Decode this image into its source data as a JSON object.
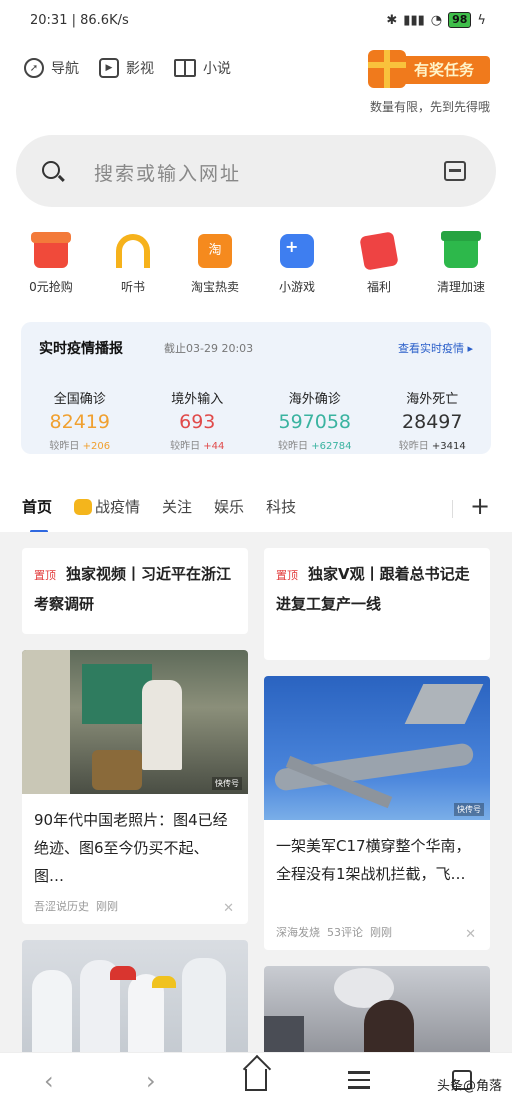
{
  "status": {
    "time": "20:31",
    "speed": "86.6K/s",
    "battery": "98",
    "icons": [
      "bluetooth-icon",
      "hd-signal-icon",
      "wifi-icon",
      "battery-icon",
      "charging-icon"
    ]
  },
  "topnav": [
    {
      "label": "导航",
      "icon": "compass-icon"
    },
    {
      "label": "影视",
      "icon": "play-icon"
    },
    {
      "label": "小说",
      "icon": "book-icon"
    }
  ],
  "reward": {
    "label": "有奖任务",
    "sub": "数量有限，先到先得哦"
  },
  "search": {
    "placeholder": "搜索或输入网址"
  },
  "quick": [
    {
      "label": "0元抢购",
      "icon": "shop-icon"
    },
    {
      "label": "听书",
      "icon": "headphones-icon"
    },
    {
      "label": "淘宝热卖",
      "icon": "taobao-bag-icon",
      "glyph": "淘"
    },
    {
      "label": "小游戏",
      "icon": "gamepad-icon"
    },
    {
      "label": "福利",
      "icon": "red-envelope-icon"
    },
    {
      "label": "清理加速",
      "icon": "trash-icon"
    }
  ],
  "epidemic": {
    "title": "实时疫情播报",
    "date": "截止03-29  20:03",
    "more": "查看实时疫情 ▸",
    "prefix": "较昨日",
    "stats": [
      {
        "label": "全国确诊",
        "value": "82419",
        "delta": "+206",
        "color": "#f0a030"
      },
      {
        "label": "境外输入",
        "value": "693",
        "delta": "+44",
        "color": "#e04a4a"
      },
      {
        "label": "海外确诊",
        "value": "597058",
        "delta": "+62784",
        "color": "#3ab3a0"
      },
      {
        "label": "海外死亡",
        "value": "28497",
        "delta": "+3414",
        "color": "#333333"
      }
    ]
  },
  "tabs": [
    "首页",
    "战疫情",
    "关注",
    "娱乐",
    "科技"
  ],
  "feed": {
    "pin_label": "置顶",
    "cards": [
      {
        "text": "独家视频丨习近平在浙江考察调研"
      },
      {
        "text": "独家V观丨跟着总书记走进复工复产一线"
      },
      {
        "text": "90年代中国老照片：图4已经绝迹、图6至今仍买不起、图…",
        "source": "吾涩说历史",
        "time": "刚刚",
        "watermark": "快传号"
      },
      {
        "text": "一架美军C17横穿整个华南，全程没有1架战机拦截，飞…",
        "source": "深海发烧",
        "comments": "53评论",
        "time": "刚刚",
        "watermark": "快传号"
      }
    ],
    "close_glyph": "✕"
  },
  "bottom": {
    "back": "‹",
    "forward": "›",
    "brand": "头条@角落"
  }
}
